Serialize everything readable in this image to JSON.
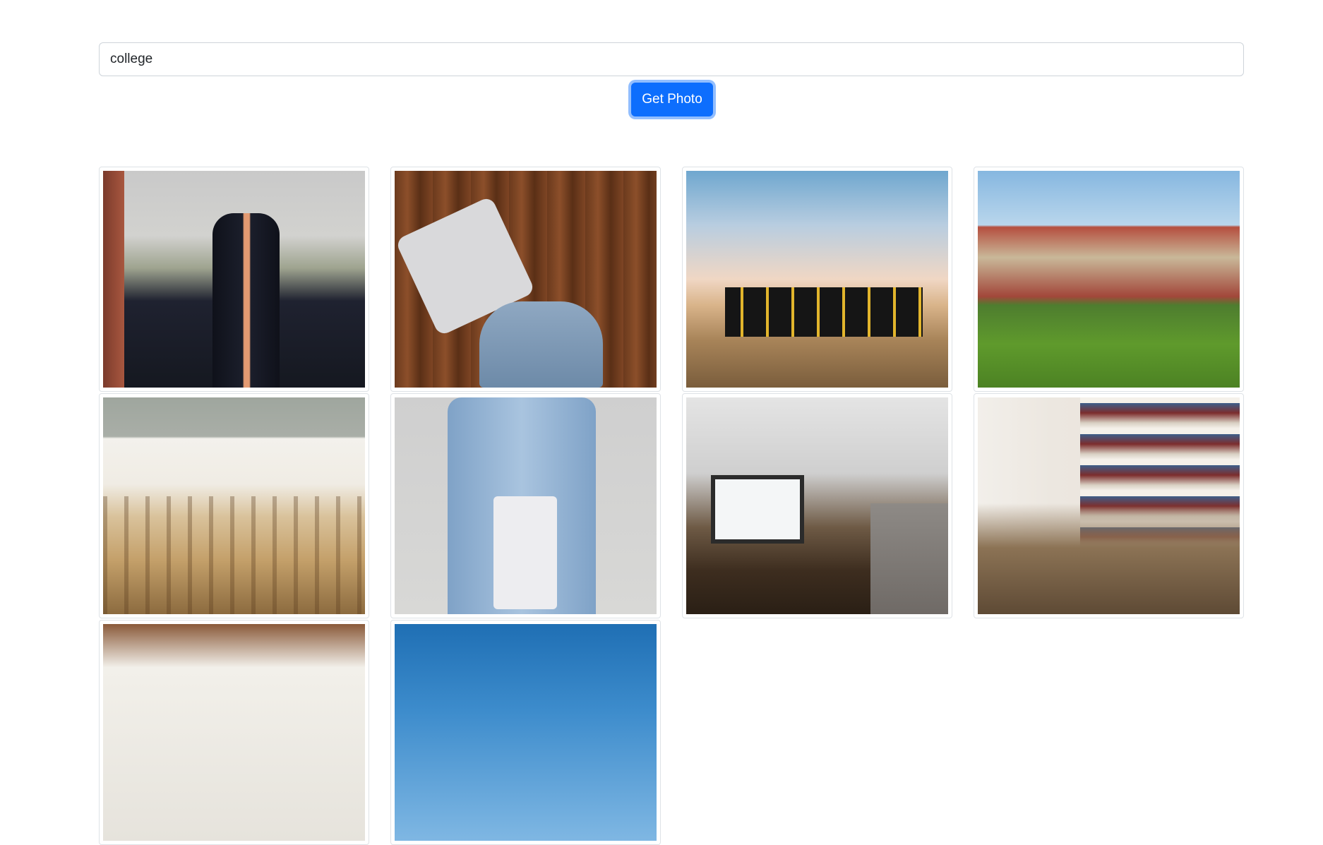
{
  "search": {
    "value": "college"
  },
  "actions": {
    "get_photo_label": "Get Photo"
  },
  "colors": {
    "primary": "#0d6efd",
    "border": "#dee2e6"
  },
  "photos": [
    {
      "icon": "graduation-crowd-photo"
    },
    {
      "icon": "laptop-notebook-backpack-photo"
    },
    {
      "icon": "graduates-throwing-caps-photo"
    },
    {
      "icon": "campus-building-lawn-photo"
    },
    {
      "icon": "empty-auditorium-seats-photo"
    },
    {
      "icon": "student-holding-books-photo"
    },
    {
      "icon": "lecture-hall-photo"
    },
    {
      "icon": "students-in-library-photo"
    },
    {
      "icon": "classroom-ceiling-photo"
    },
    {
      "icon": "blue-sky-tower-photo"
    }
  ]
}
